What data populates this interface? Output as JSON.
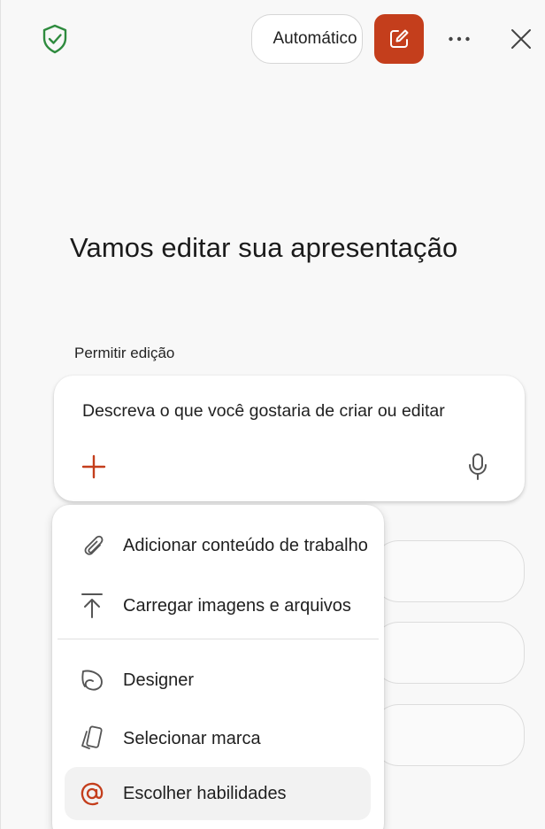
{
  "header": {
    "mode_label": "Automático",
    "icons": {
      "shield": "shield-check-icon",
      "compose": "compose-icon",
      "more": "more-horizontal-icon",
      "close": "close-icon"
    }
  },
  "colors": {
    "accent": "#c43e1c",
    "shield": "#2e8b3e"
  },
  "main": {
    "heading": "Vamos editar sua apresentação",
    "permission_label": "Permitir edição",
    "prompt": {
      "placeholder": "Descreva o que você gostaria de criar ou editar",
      "add_icon": "plus-icon",
      "mic_icon": "microphone-icon"
    }
  },
  "menu": {
    "items": [
      {
        "label": "Adicionar conteúdo de trabalho",
        "icon": "paperclip-icon"
      },
      {
        "label": "Carregar imagens e arquivos",
        "icon": "upload-icon"
      },
      {
        "label": "Designer",
        "icon": "designer-icon"
      },
      {
        "label": "Selecionar marca",
        "icon": "brand-icon"
      },
      {
        "label": "Escolher habilidades",
        "icon": "at-sign-icon",
        "active": true
      }
    ]
  }
}
